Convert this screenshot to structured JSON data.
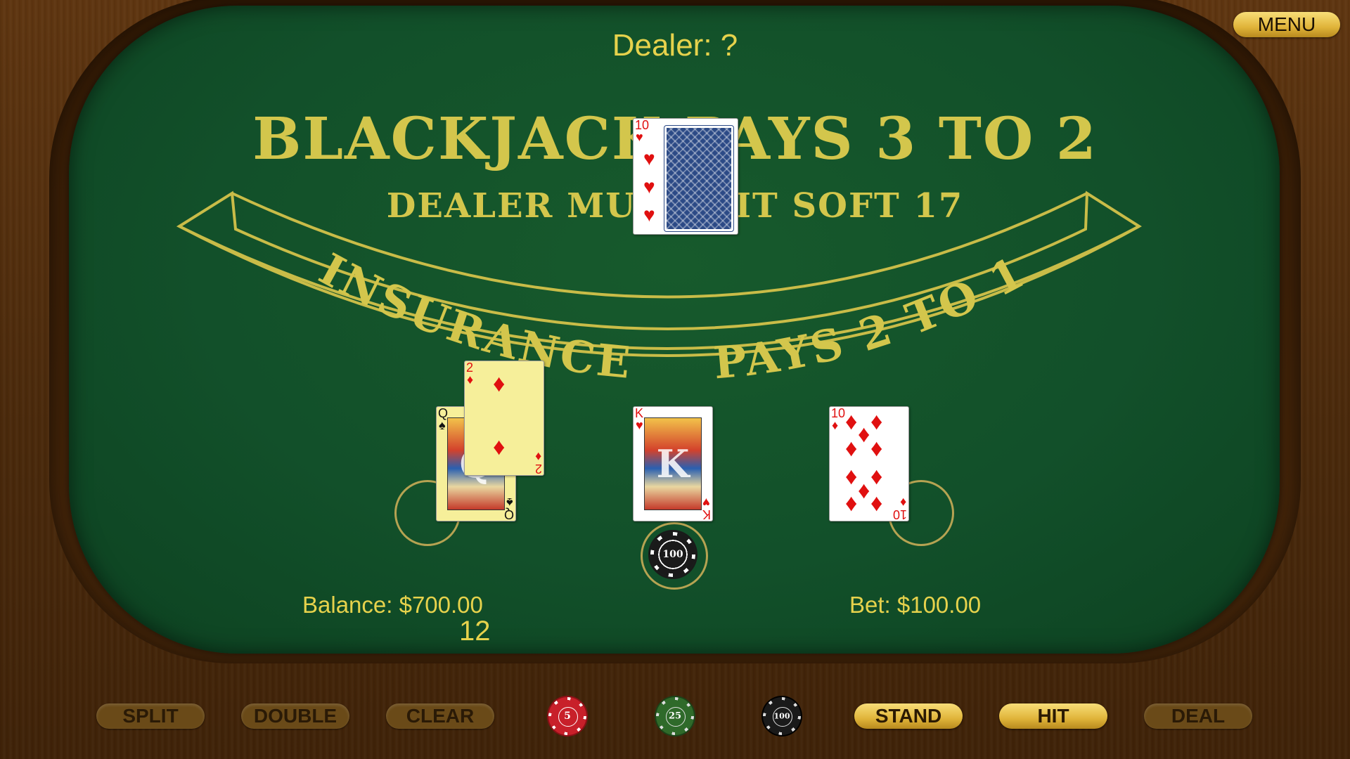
{
  "header": {
    "dealer_label": "Dealer: ?",
    "menu_label": "MENU"
  },
  "table": {
    "title_line1": "BLACKJACK PAYS 3 TO 2",
    "title_line2": "DEALER MUST HIT SOFT 17",
    "insurance_left": "INSURANCE",
    "insurance_right": "PAYS 2 TO 1"
  },
  "dealer_hand": {
    "cards": [
      {
        "rank": "10",
        "suit": "♥",
        "color": "red",
        "face": "up"
      },
      {
        "face": "down"
      }
    ]
  },
  "player_hands": {
    "left": {
      "cards": [
        {
          "rank": "Q",
          "suit": "♠"
        },
        {
          "rank": "2",
          "suit": "♦"
        }
      ]
    },
    "center": {
      "cards": [
        {
          "rank": "K",
          "suit": "♥"
        }
      ],
      "bet_chip": "100"
    },
    "right": {
      "cards": [
        {
          "rank": "10",
          "suit": "♦"
        }
      ]
    }
  },
  "status": {
    "balance": "Balance: $700.00",
    "hand_total": "12",
    "bet": "Bet: $100.00"
  },
  "controls": {
    "split": "SPLIT",
    "double": "DOUBLE",
    "clear": "CLEAR",
    "stand": "STAND",
    "hit": "HIT",
    "deal": "DEAL",
    "chips": [
      {
        "value": "5",
        "color": "#c8202a"
      },
      {
        "value": "25",
        "color": "#2f6a2a"
      },
      {
        "value": "100",
        "color": "#1a1a1a"
      }
    ],
    "enabled": [
      "STAND",
      "HIT"
    ]
  },
  "colors": {
    "felt": "#12502a",
    "gold_text": "#e6d24c",
    "print": "#d3c64c",
    "wood": "#5e3510"
  }
}
